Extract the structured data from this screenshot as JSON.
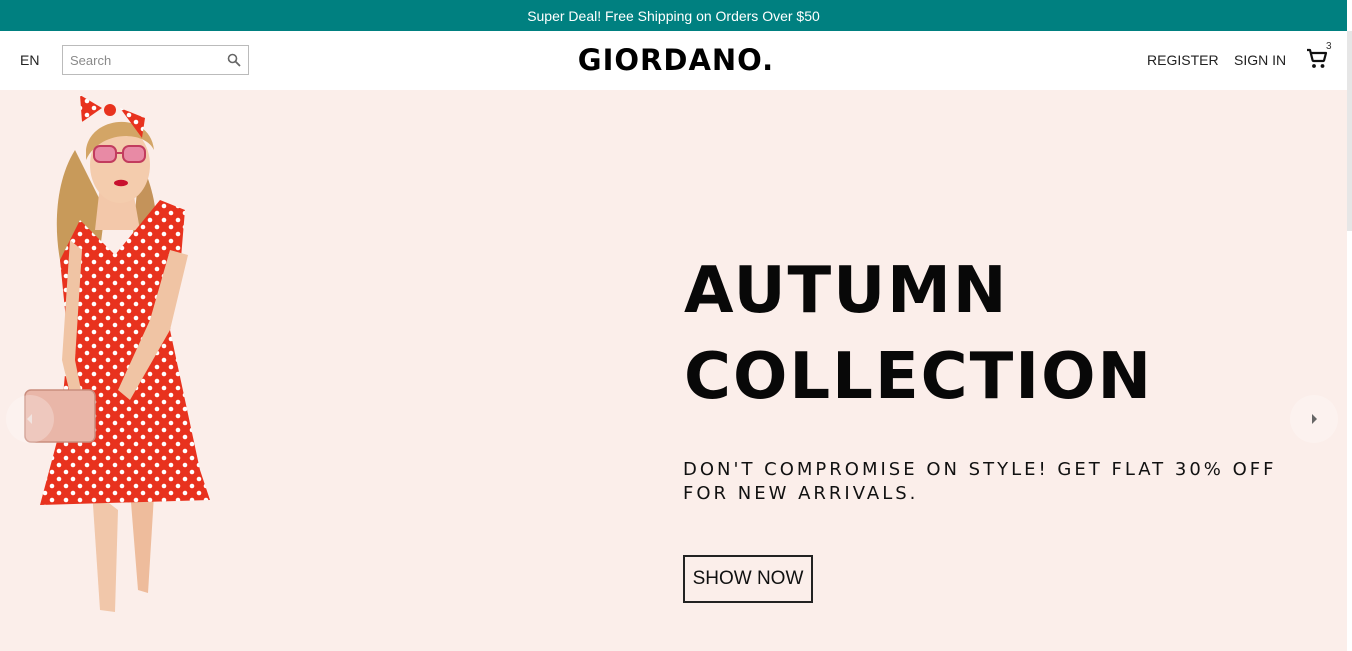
{
  "announcement": {
    "text": "Super Deal! Free Shipping on Orders Over $50"
  },
  "header": {
    "language": "EN",
    "search_placeholder": "Search",
    "logo": "GIORDANO.",
    "register": "REGISTER",
    "sign_in": "SIGN IN",
    "cart_count": "3"
  },
  "hero": {
    "headline_line1": "AUTUMN",
    "headline_line2": "COLLECTION",
    "subtext_line1": "DON'T COMPROMISE ON STYLE! GET FLAT 30% OFF",
    "subtext_line2": "FOR NEW ARRIVALS.",
    "cta": "SHOW NOW"
  },
  "colors": {
    "announcement_bg": "#008080",
    "hero_bg": "#fbeeea",
    "dress": "#e8321e"
  },
  "icons": [
    "search-icon",
    "cart-icon",
    "chevron-left-icon",
    "chevron-right-icon"
  ]
}
